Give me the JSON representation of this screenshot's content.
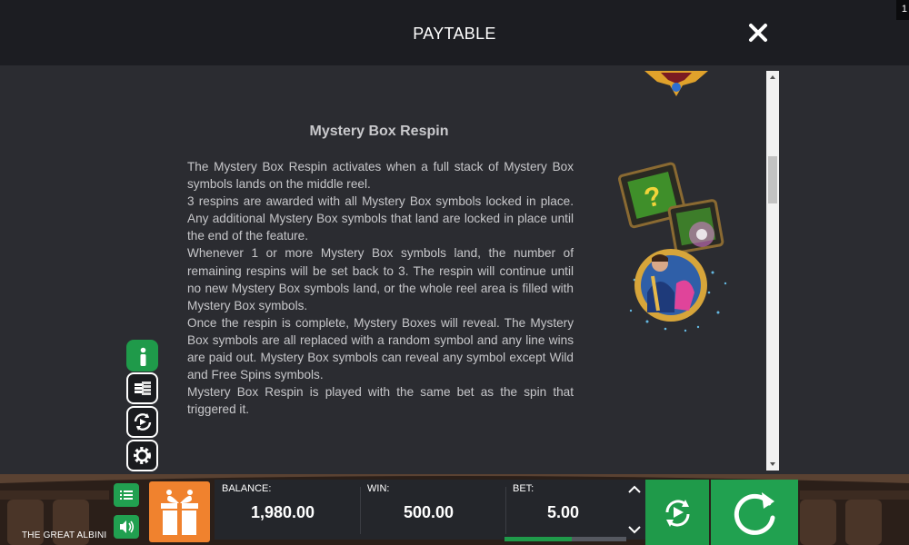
{
  "header": {
    "title": "PAYTABLE",
    "corner_badge": "1"
  },
  "content": {
    "heading": "Mystery Box Respin",
    "paragraphs": [
      "The Mystery Box Respin activates when a full stack of Mystery Box symbols lands on the middle reel.",
      "3 respins are awarded with all Mystery Box symbols locked in place. Any additional Mystery Box symbols that land are locked in place until the end of the feature.",
      "Whenever 1 or more Mystery Box symbols land, the number of remaining respins will be set back to 3. The respin will continue until no new Mystery Box symbols land, or the whole reel area is filled with Mystery Box symbols.",
      "Once the respin is complete, Mystery Boxes will reveal. The Mystery Box symbols are all replaced with a random symbol and any line wins are paid out. Mystery Box symbols can reveal any symbol except Wild and Free Spins symbols.",
      "Mystery Box Respin is played with the same bet as the spin that triggered it."
    ]
  },
  "footer": {
    "game_name": "THE GREAT ALBINI",
    "balance_label": "BALANCE:",
    "balance_value": "1,980.00",
    "win_label": "WIN:",
    "win_value": "500.00",
    "bet_label": "BET:",
    "bet_value": "5.00"
  },
  "colors": {
    "accent_green": "#1f9a4a",
    "gift_orange": "#f0822e",
    "panel_bg": "#2b2c31"
  },
  "icons": [
    "close-icon",
    "info-icon",
    "coins-icon",
    "autoplay-icon",
    "settings-icon",
    "menu-icon",
    "sound-icon",
    "gift-icon",
    "chevron-up-icon",
    "chevron-down-icon",
    "spin-icon"
  ]
}
